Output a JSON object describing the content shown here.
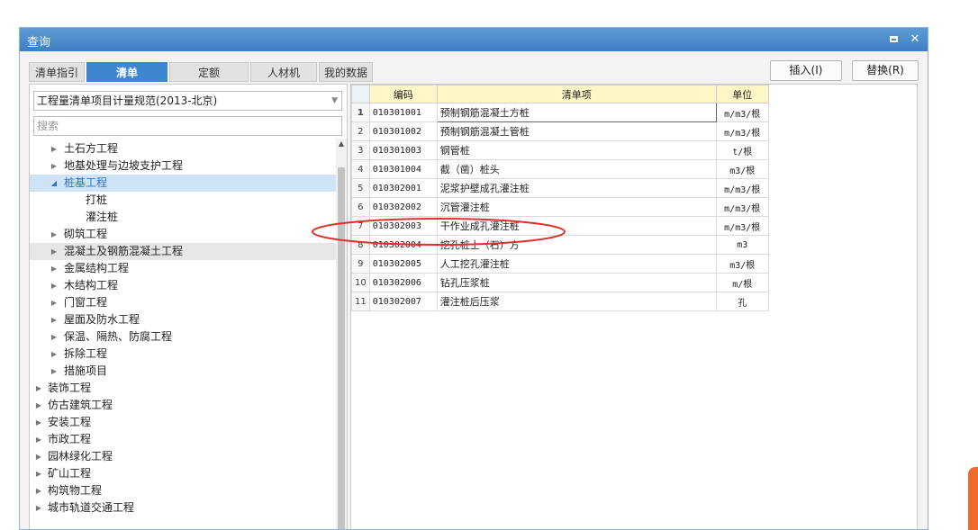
{
  "window": {
    "title": "查询"
  },
  "tabs": [
    {
      "label": "清单指引"
    },
    {
      "label": "清单"
    },
    {
      "label": "定额"
    },
    {
      "label": "人材机"
    },
    {
      "label": "我的数据"
    }
  ],
  "active_tab": "清单",
  "actions": {
    "insert_label": "插入(I)",
    "replace_label": "替换(R)"
  },
  "standard_select": {
    "value": "工程量清单项目计量规范(2013-北京)"
  },
  "search": {
    "placeholder": "搜索"
  },
  "tree": [
    {
      "label": "土石方工程"
    },
    {
      "label": "地基处理与边坡支护工程"
    },
    {
      "label": "桩基工程"
    },
    {
      "label": "打桩"
    },
    {
      "label": "灌注桩"
    },
    {
      "label": "砌筑工程"
    },
    {
      "label": "混凝土及钢筋混凝土工程"
    },
    {
      "label": "金属结构工程"
    },
    {
      "label": "木结构工程"
    },
    {
      "label": "门窗工程"
    },
    {
      "label": "屋面及防水工程"
    },
    {
      "label": "保温、隔热、防腐工程"
    },
    {
      "label": "拆除工程"
    },
    {
      "label": "措施项目"
    },
    {
      "label": "装饰工程"
    },
    {
      "label": "仿古建筑工程"
    },
    {
      "label": "安装工程"
    },
    {
      "label": "市政工程"
    },
    {
      "label": "园林绿化工程"
    },
    {
      "label": "矿山工程"
    },
    {
      "label": "构筑物工程"
    },
    {
      "label": "城市轨道交通工程"
    }
  ],
  "table": {
    "headers": {
      "code": "编码",
      "name": "清单项",
      "unit": "单位"
    },
    "rows": [
      {
        "no": "1",
        "code": "010301001",
        "name": "预制钢筋混凝土方桩",
        "unit": "m/m3/根"
      },
      {
        "no": "2",
        "code": "010301002",
        "name": "预制钢筋混凝土管桩",
        "unit": "m/m3/根"
      },
      {
        "no": "3",
        "code": "010301003",
        "name": "钢管桩",
        "unit": "t/根"
      },
      {
        "no": "4",
        "code": "010301004",
        "name": "截（凿）桩头",
        "unit": "m3/根"
      },
      {
        "no": "5",
        "code": "010302001",
        "name": "泥浆护壁成孔灌注桩",
        "unit": "m/m3/根"
      },
      {
        "no": "6",
        "code": "010302002",
        "name": "沉管灌注桩",
        "unit": "m/m3/根"
      },
      {
        "no": "7",
        "code": "010302003",
        "name": "干作业成孔灌注桩",
        "unit": "m/m3/根"
      },
      {
        "no": "8",
        "code": "010302004",
        "name": "挖孔桩土（石）方",
        "unit": "m3"
      },
      {
        "no": "9",
        "code": "010302005",
        "name": "人工挖孔灌注桩",
        "unit": "m3/根"
      },
      {
        "no": "10",
        "code": "010302006",
        "name": "钻孔压浆桩",
        "unit": "m/根"
      },
      {
        "no": "11",
        "code": "010302007",
        "name": "灌注桩后压浆",
        "unit": "孔"
      }
    ]
  },
  "colors": {
    "titlebar": "#4a8ccc",
    "active_tab": "#3e86d0",
    "header_bg": "#fff6c8",
    "annotation": "#e0302e",
    "side_tab": "#f06a2a"
  }
}
